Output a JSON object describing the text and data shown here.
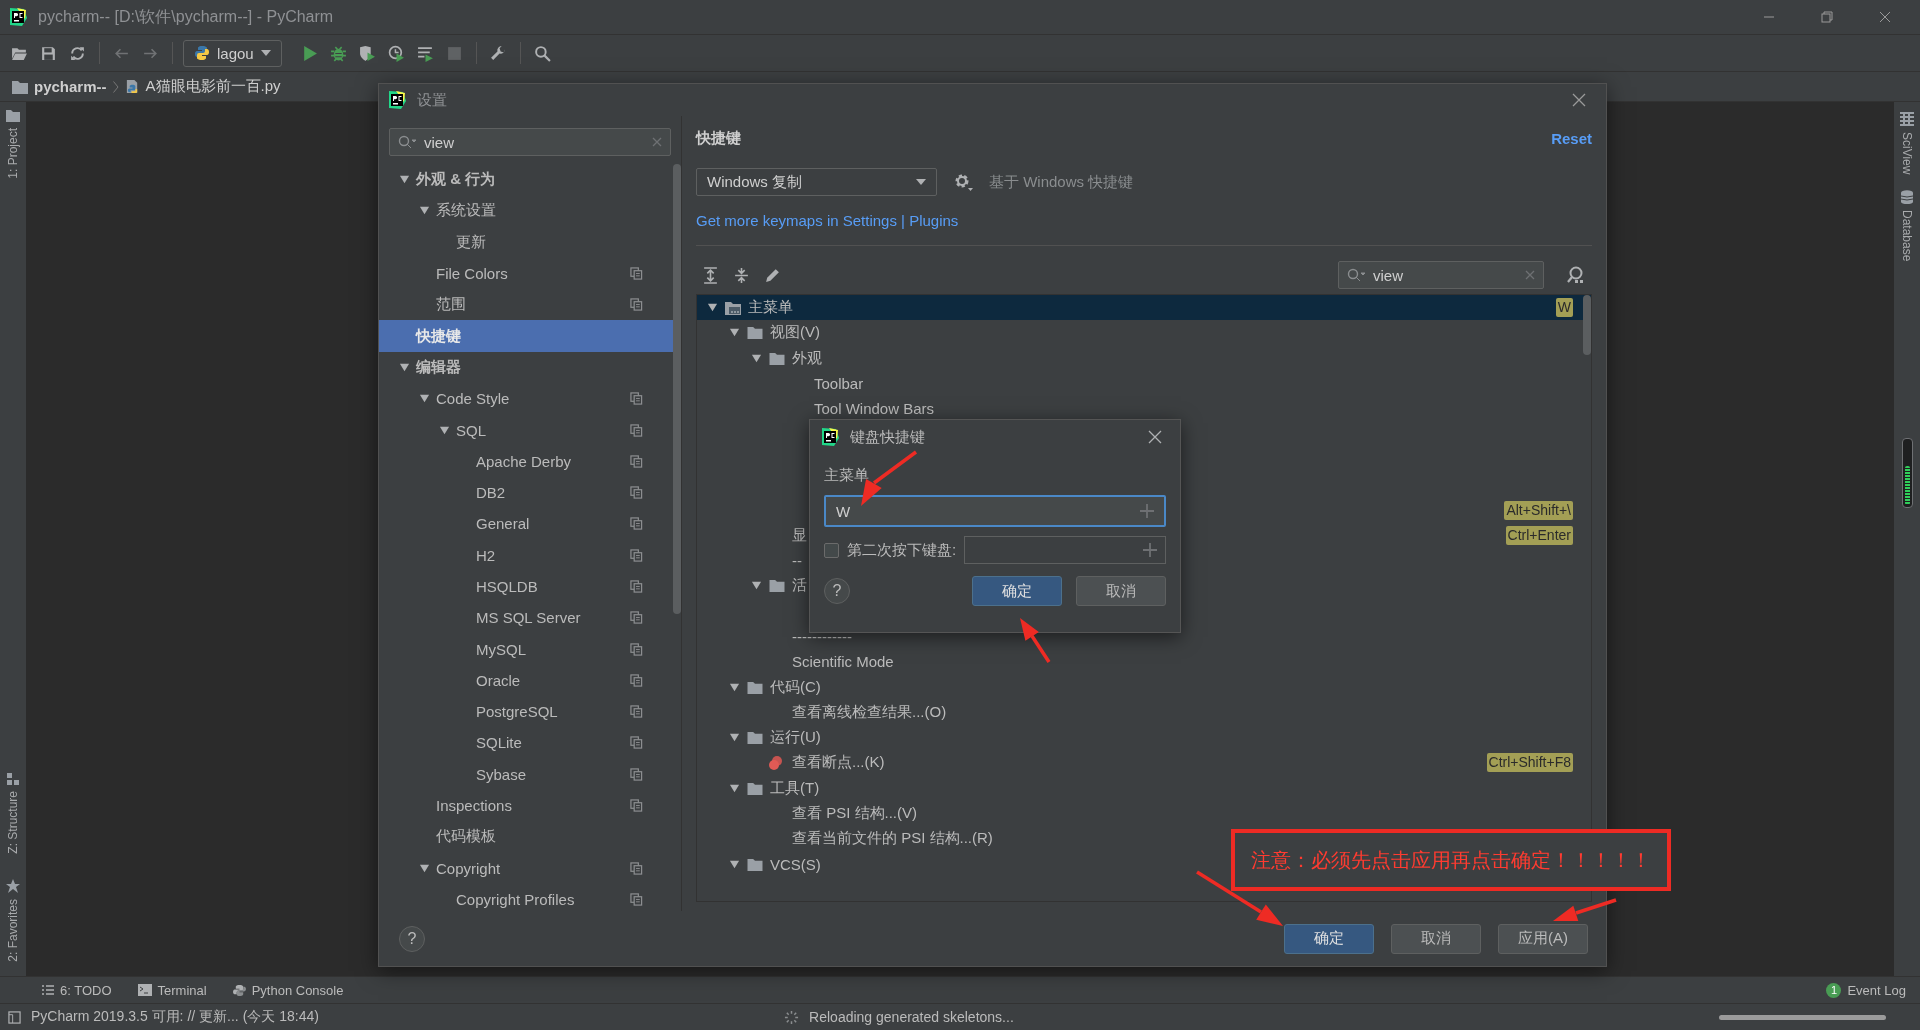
{
  "window": {
    "title": "pycharm-- [D:\\软件\\pycharm--] - PyCharm"
  },
  "toolbar": {
    "items": [
      {
        "kind": "open",
        "disabled": false
      },
      {
        "kind": "save",
        "disabled": false
      },
      {
        "kind": "sync",
        "disabled": false
      },
      {
        "kind": "back",
        "disabled": true
      },
      {
        "kind": "forward",
        "disabled": true
      },
      {
        "kind": "run-config",
        "label": "lagou",
        "disabled": false
      },
      {
        "kind": "run",
        "disabled": false
      },
      {
        "kind": "debug",
        "disabled": false
      },
      {
        "kind": "coverage",
        "disabled": false
      },
      {
        "kind": "profile",
        "disabled": false
      },
      {
        "kind": "concurrency",
        "disabled": false
      },
      {
        "kind": "stop",
        "disabled": true
      },
      {
        "kind": "wrench",
        "disabled": false
      },
      {
        "kind": "search",
        "disabled": false
      }
    ]
  },
  "breadcrumb": [
    {
      "kind": "project",
      "label": "pycharm--"
    },
    {
      "kind": "file",
      "label": "A猫眼电影前一百.py"
    }
  ],
  "left_stripe": {
    "top": [
      {
        "kind": "project",
        "label": "1: Project"
      }
    ],
    "bottom": [
      {
        "kind": "structure",
        "label": "Z: Structure"
      },
      {
        "kind": "favorites",
        "label": "2: Favorites"
      }
    ]
  },
  "right_stripe": {
    "tabs": [
      {
        "kind": "sciview",
        "label": "SciView"
      },
      {
        "kind": "database",
        "label": "Database"
      }
    ],
    "memory": {
      "level": 0.6
    }
  },
  "settings": {
    "title": "设置",
    "search": "view",
    "tree": [
      {
        "label": "外观 & 行为",
        "expanded": true,
        "selected": false,
        "project_scoped": false,
        "children": [
          {
            "label": "系统设置",
            "expanded": true,
            "selected": false,
            "project_scoped": false,
            "children": [
              {
                "label": "更新",
                "selected": false,
                "project_scoped": false
              }
            ]
          },
          {
            "label": "File Colors",
            "selected": false,
            "project_scoped": true
          },
          {
            "label": "范围",
            "selected": false,
            "project_scoped": true
          }
        ]
      },
      {
        "label": "快捷键",
        "selected": true,
        "project_scoped": false
      },
      {
        "label": "编辑器",
        "expanded": true,
        "selected": false,
        "project_scoped": false,
        "children": [
          {
            "label": "Code Style",
            "expanded": true,
            "selected": false,
            "project_scoped": true,
            "children": [
              {
                "label": "SQL",
                "expanded": true,
                "selected": false,
                "project_scoped": true,
                "children": [
                  {
                    "label": "Apache Derby",
                    "selected": false,
                    "project_scoped": true
                  },
                  {
                    "label": "DB2",
                    "selected": false,
                    "project_scoped": true
                  },
                  {
                    "label": "General",
                    "selected": false,
                    "project_scoped": true
                  },
                  {
                    "label": "H2",
                    "selected": false,
                    "project_scoped": true
                  },
                  {
                    "label": "HSQLDB",
                    "selected": false,
                    "project_scoped": true
                  },
                  {
                    "label": "MS SQL Server",
                    "selected": false,
                    "project_scoped": true
                  },
                  {
                    "label": "MySQL",
                    "selected": false,
                    "project_scoped": true
                  },
                  {
                    "label": "Oracle",
                    "selected": false,
                    "project_scoped": true
                  },
                  {
                    "label": "PostgreSQL",
                    "selected": false,
                    "project_scoped": true
                  },
                  {
                    "label": "SQLite",
                    "selected": false,
                    "project_scoped": true
                  },
                  {
                    "label": "Sybase",
                    "selected": false,
                    "project_scoped": true
                  }
                ]
              }
            ]
          },
          {
            "label": "Inspections",
            "selected": false,
            "project_scoped": true
          },
          {
            "label": "代码模板",
            "selected": false,
            "project_scoped": false
          },
          {
            "label": "Copyright",
            "expanded": true,
            "selected": false,
            "project_scoped": true,
            "children": [
              {
                "label": "Copyright Profiles",
                "selected": false,
                "project_scoped": true
              }
            ]
          }
        ]
      }
    ],
    "section_title": "快捷键",
    "reset": "Reset",
    "keymap": "Windows 复制",
    "keymap_note": "基于 Windows 快捷键",
    "plugins_link": "Get more keymaps in Settings | Plugins",
    "action_search": "view",
    "actions": [
      {
        "kind": "menu",
        "label": "主菜单",
        "expanded": true,
        "selected": true,
        "shortcut": "W",
        "children": [
          {
            "kind": "folder",
            "label": "视图(V)",
            "expanded": true,
            "selected": false,
            "children": [
              {
                "kind": "folder",
                "label": "外观",
                "expanded": true,
                "selected": false,
                "children": [
                  {
                    "kind": "action",
                    "label": "Toolbar",
                    "selected": false
                  },
                  {
                    "kind": "action",
                    "label": "Tool Window Bars",
                    "selected": false
                  },
                  {
                    "kind": "action",
                    "selected": false
                  },
                  {
                    "kind": "action",
                    "selected": false
                  },
                  {
                    "kind": "action",
                    "selected": false
                  },
                  {
                    "kind": "action",
                    "selected": false,
                    "shortcut": "Alt+Shift+\\"
                  }
                ]
              },
              {
                "kind": "action",
                "label": "显",
                "selected": false,
                "shortcut": "Ctrl+Enter"
              },
              {
                "kind": "action",
                "label": "--",
                "selected": false
              },
              {
                "kind": "folder",
                "label": "活",
                "expanded": true,
                "selected": false,
                "children": [
                  {
                    "kind": "action",
                    "selected": false
                  }
                ]
              },
              {
                "kind": "action",
                "label": "------------",
                "selected": false
              },
              {
                "kind": "action",
                "label": "Scientific Mode",
                "selected": false
              }
            ]
          },
          {
            "kind": "folder",
            "label": "代码(C)",
            "expanded": true,
            "selected": false,
            "children": [
              {
                "kind": "action",
                "label": "查看离线检查结果...(O)",
                "selected": false
              }
            ]
          },
          {
            "kind": "folder",
            "label": "运行(U)",
            "expanded": true,
            "selected": false,
            "children": [
              {
                "kind": "breakpoint",
                "label": "查看断点...(K)",
                "selected": false,
                "shortcut": "Ctrl+Shift+F8"
              }
            ]
          },
          {
            "kind": "folder",
            "label": "工具(T)",
            "expanded": true,
            "selected": false,
            "children": [
              {
                "kind": "action",
                "label": "查看 PSI 结构...(V)",
                "selected": false
              },
              {
                "kind": "action",
                "label": "查看当前文件的 PSI 结构...(R)",
                "selected": false
              }
            ]
          },
          {
            "kind": "folder",
            "label": "VCS(S)",
            "expanded": true,
            "selected": false
          }
        ]
      }
    ],
    "help": "?",
    "buttons": [
      {
        "label": "确定",
        "default": true
      },
      {
        "label": "取消",
        "default": false
      },
      {
        "label": "应用(A)",
        "default": false
      }
    ]
  },
  "shortcut_dialog": {
    "title": "键盘快捷键",
    "action": "主菜单",
    "first_stroke": "W",
    "second_stroke_enabled": false,
    "second_stroke_label": "第二次按下键盘:",
    "help": "?",
    "buttons": [
      {
        "label": "确定",
        "default": true
      },
      {
        "label": "取消",
        "default": false
      }
    ]
  },
  "annotation": {
    "note": "注意：必须先点击应用再点击确定！！！！！"
  },
  "tool_windows": [
    {
      "kind": "todo",
      "label": "6: TODO"
    },
    {
      "kind": "terminal",
      "label": "Terminal"
    },
    {
      "kind": "python",
      "label": "Python Console"
    }
  ],
  "event_log": {
    "count": "1",
    "label": "Event Log"
  },
  "status_bar": {
    "message": "PyCharm 2019.3.5 可用: // 更新... (今天 18:44)",
    "task": "Reloading generated skeletons...",
    "progress": {
      "level": 1
    }
  }
}
